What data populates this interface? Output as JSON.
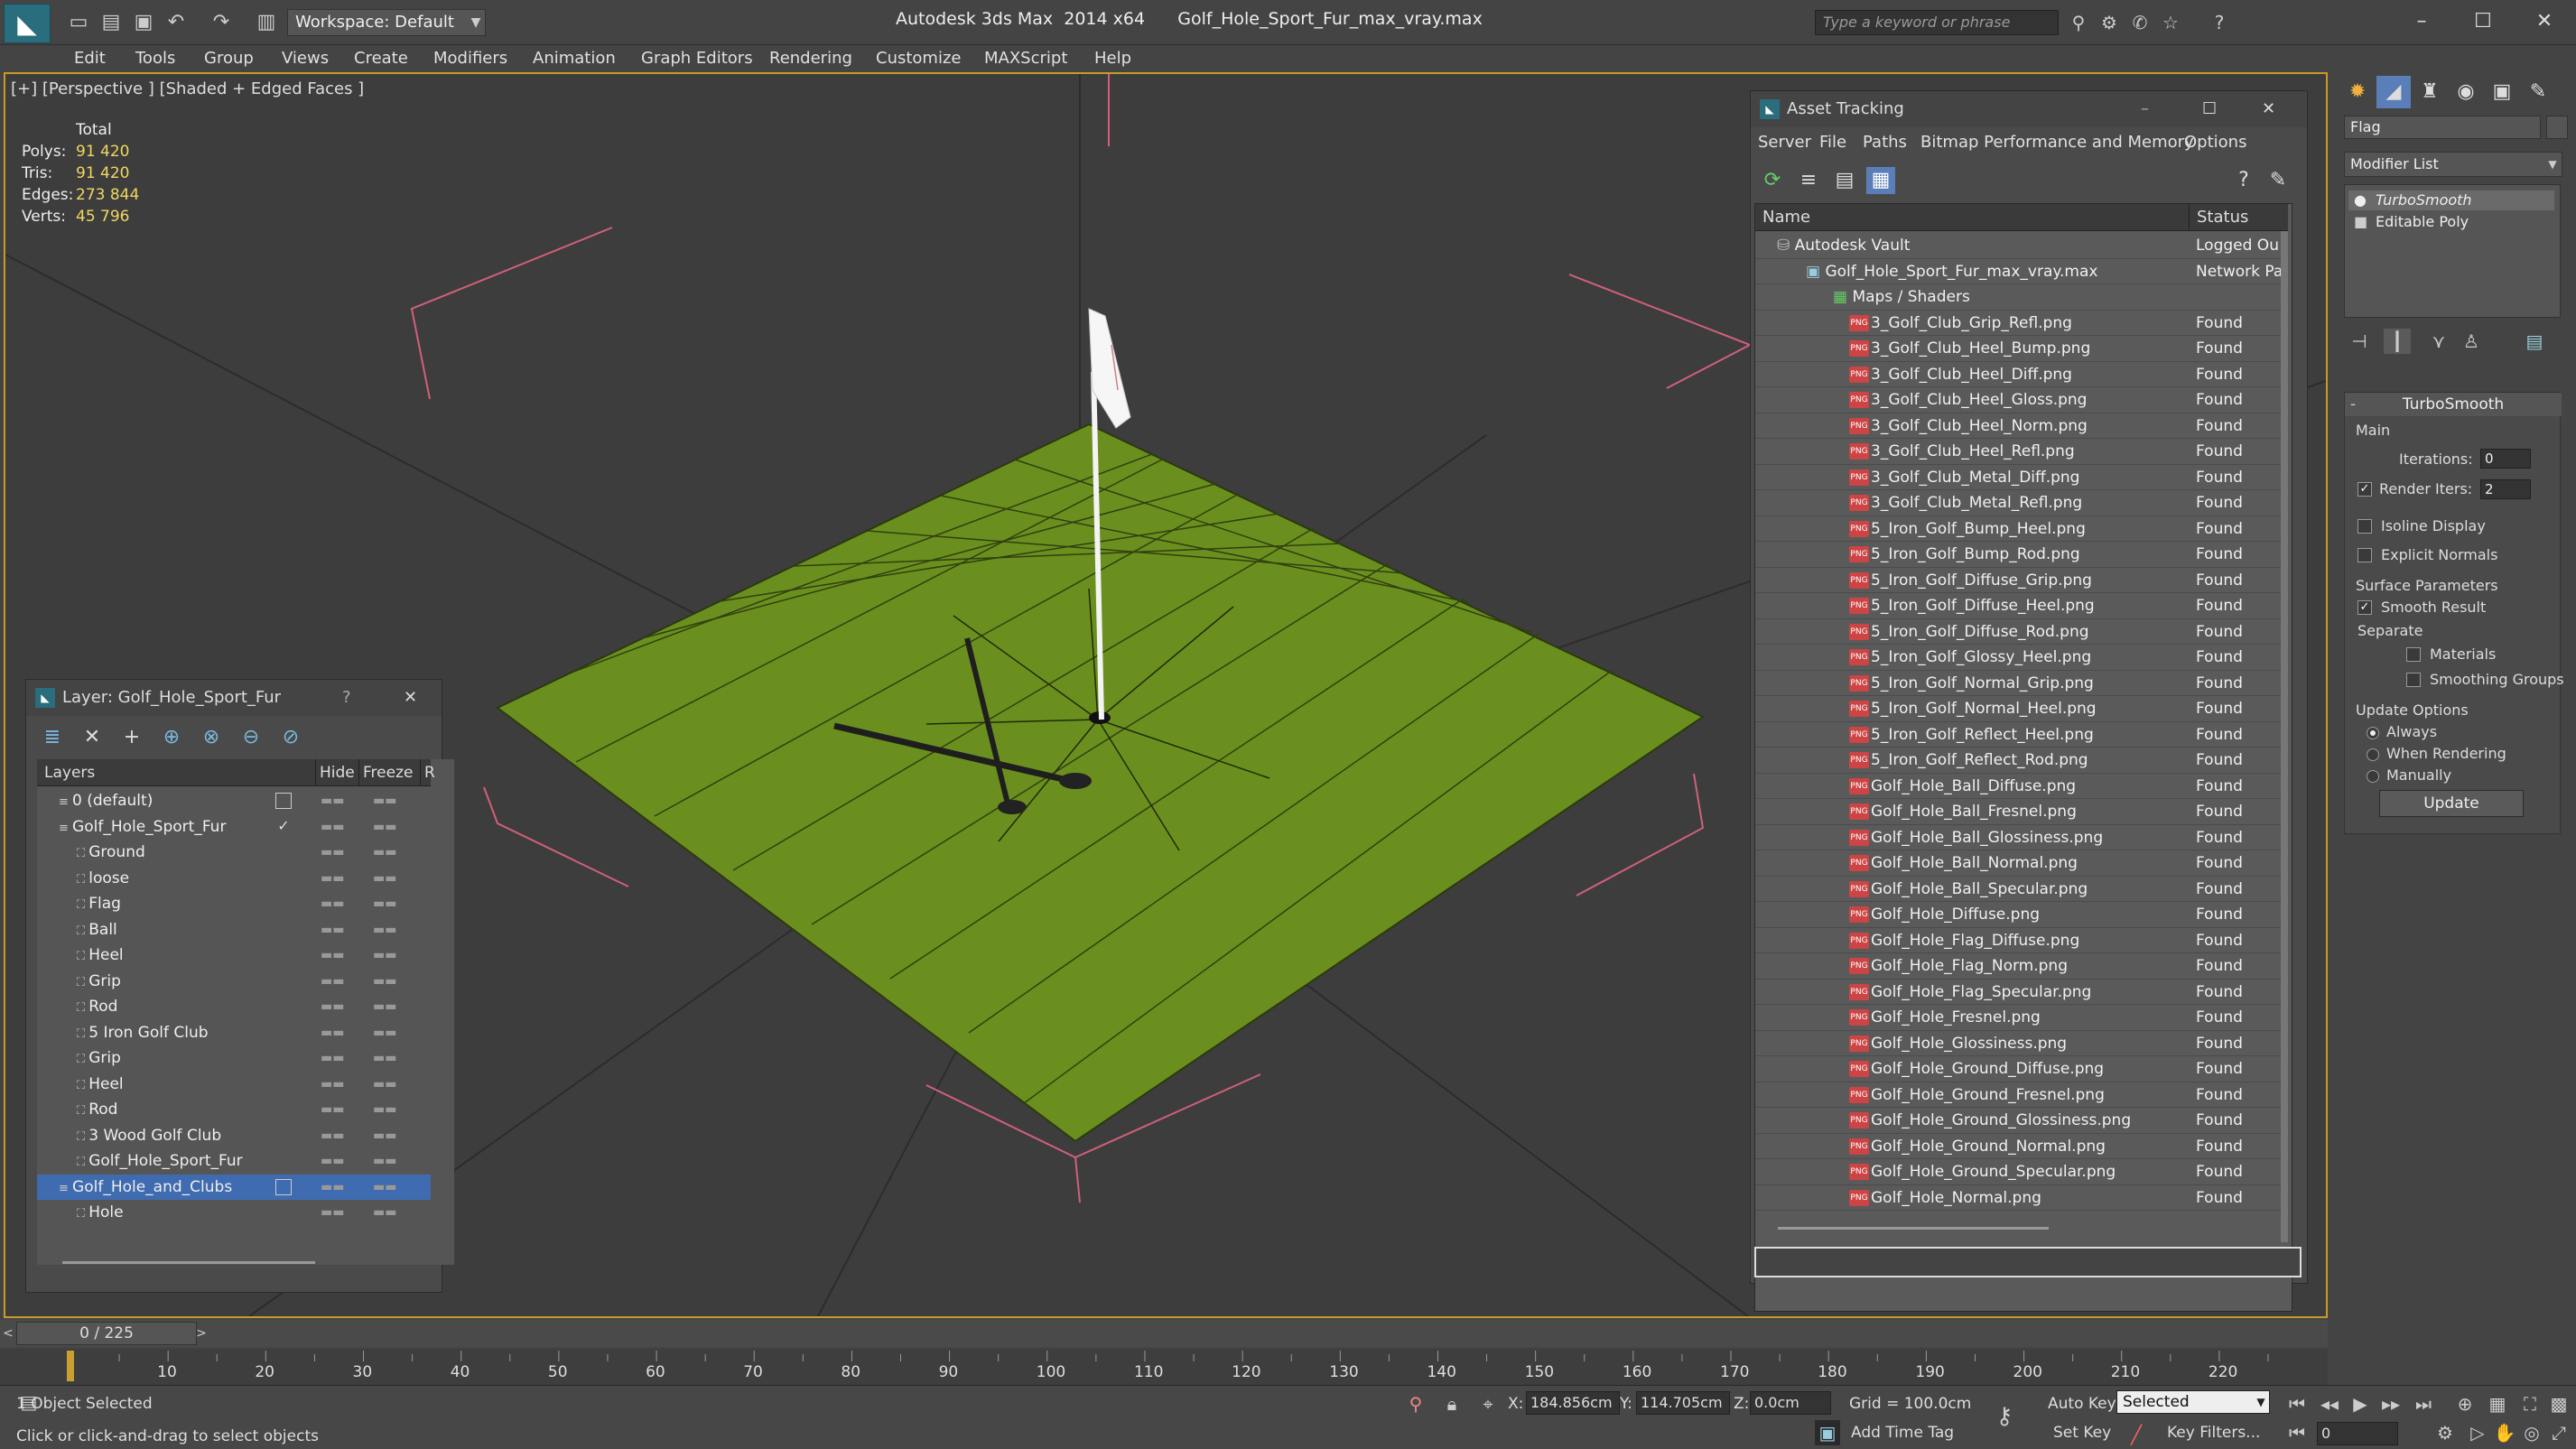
{
  "title_bar": {
    "workspace": "Workspace: Default",
    "app_title": "Autodesk 3ds Max  2014 x64      Golf_Hole_Sport_Fur_max_vray.max",
    "search_placeholder": "Type a keyword or phrase"
  },
  "menu": [
    "Edit",
    "Tools",
    "Group",
    "Views",
    "Create",
    "Modifiers",
    "Animation",
    "Graph Editors",
    "Rendering",
    "Customize",
    "MAXScript",
    "Help"
  ],
  "viewport": {
    "label": "[+] [Perspective ] [Shaded + Edged Faces ]",
    "stats_header": "Total",
    "stats": [
      {
        "k": "Polys:",
        "v": "91 420"
      },
      {
        "k": "Tris:",
        "v": "91 420"
      },
      {
        "k": "Edges:",
        "v": "273 844"
      },
      {
        "k": "Verts:",
        "v": "45 796"
      }
    ]
  },
  "layer_panel": {
    "title": "Layer: Golf_Hole_Sport_Fur",
    "help": "?",
    "col_layers": "Layers",
    "col_hide": "Hide",
    "col_freeze": "Freeze",
    "col_r": "R",
    "rows": [
      {
        "name": "0 (default)",
        "indent": 1,
        "box": true,
        "check": ""
      },
      {
        "name": "Golf_Hole_Sport_Fur",
        "indent": 1,
        "box": false,
        "check": "✓"
      },
      {
        "name": "Ground",
        "indent": 2
      },
      {
        "name": "loose",
        "indent": 2
      },
      {
        "name": "Flag",
        "indent": 2
      },
      {
        "name": "Ball",
        "indent": 2
      },
      {
        "name": "Heel",
        "indent": 2
      },
      {
        "name": "Grip",
        "indent": 2
      },
      {
        "name": "Rod",
        "indent": 2
      },
      {
        "name": "5 Iron Golf Club",
        "indent": 2
      },
      {
        "name": "Grip",
        "indent": 2
      },
      {
        "name": "Heel",
        "indent": 2
      },
      {
        "name": "Rod",
        "indent": 2
      },
      {
        "name": "3 Wood Golf Club",
        "indent": 2
      },
      {
        "name": "Golf_Hole_Sport_Fur",
        "indent": 2
      },
      {
        "name": "Golf_Hole_and_Clubs",
        "indent": 1,
        "box": true,
        "selected": true
      },
      {
        "name": "Hole",
        "indent": 2
      }
    ]
  },
  "asset_panel": {
    "title": "Asset Tracking",
    "menu": [
      "Server",
      "File",
      "Paths",
      "Bitmap Performance and Memory",
      "Options"
    ],
    "col_name": "Name",
    "col_status": "Status",
    "rows": [
      {
        "name": "Autodesk Vault",
        "status": "Logged Ou",
        "level": 0,
        "icon": "vault"
      },
      {
        "name": "Golf_Hole_Sport_Fur_max_vray.max",
        "status": "Network Pa",
        "level": 1,
        "icon": "max"
      },
      {
        "name": "Maps / Shaders",
        "status": "",
        "level": 2,
        "icon": "maps"
      },
      {
        "name": "3_Golf_Club_Grip_Refl.png",
        "status": "Found",
        "level": 3
      },
      {
        "name": "3_Golf_Club_Heel_Bump.png",
        "status": "Found",
        "level": 3
      },
      {
        "name": "3_Golf_Club_Heel_Diff.png",
        "status": "Found",
        "level": 3
      },
      {
        "name": "3_Golf_Club_Heel_Gloss.png",
        "status": "Found",
        "level": 3
      },
      {
        "name": "3_Golf_Club_Heel_Norm.png",
        "status": "Found",
        "level": 3
      },
      {
        "name": "3_Golf_Club_Heel_Refl.png",
        "status": "Found",
        "level": 3
      },
      {
        "name": "3_Golf_Club_Metal_Diff.png",
        "status": "Found",
        "level": 3
      },
      {
        "name": "3_Golf_Club_Metal_Refl.png",
        "status": "Found",
        "level": 3
      },
      {
        "name": "5_Iron_Golf_Bump_Heel.png",
        "status": "Found",
        "level": 3
      },
      {
        "name": "5_Iron_Golf_Bump_Rod.png",
        "status": "Found",
        "level": 3
      },
      {
        "name": "5_Iron_Golf_Diffuse_Grip.png",
        "status": "Found",
        "level": 3
      },
      {
        "name": "5_Iron_Golf_Diffuse_Heel.png",
        "status": "Found",
        "level": 3
      },
      {
        "name": "5_Iron_Golf_Diffuse_Rod.png",
        "status": "Found",
        "level": 3
      },
      {
        "name": "5_Iron_Golf_Glossy_Heel.png",
        "status": "Found",
        "level": 3
      },
      {
        "name": "5_Iron_Golf_Normal_Grip.png",
        "status": "Found",
        "level": 3
      },
      {
        "name": "5_Iron_Golf_Normal_Heel.png",
        "status": "Found",
        "level": 3
      },
      {
        "name": "5_Iron_Golf_Reflect_Heel.png",
        "status": "Found",
        "level": 3
      },
      {
        "name": "5_Iron_Golf_Reflect_Rod.png",
        "status": "Found",
        "level": 3
      },
      {
        "name": "Golf_Hole_Ball_Diffuse.png",
        "status": "Found",
        "level": 3
      },
      {
        "name": "Golf_Hole_Ball_Fresnel.png",
        "status": "Found",
        "level": 3
      },
      {
        "name": "Golf_Hole_Ball_Glossiness.png",
        "status": "Found",
        "level": 3
      },
      {
        "name": "Golf_Hole_Ball_Normal.png",
        "status": "Found",
        "level": 3
      },
      {
        "name": "Golf_Hole_Ball_Specular.png",
        "status": "Found",
        "level": 3
      },
      {
        "name": "Golf_Hole_Diffuse.png",
        "status": "Found",
        "level": 3
      },
      {
        "name": "Golf_Hole_Flag_Diffuse.png",
        "status": "Found",
        "level": 3
      },
      {
        "name": "Golf_Hole_Flag_Norm.png",
        "status": "Found",
        "level": 3
      },
      {
        "name": "Golf_Hole_Flag_Specular.png",
        "status": "Found",
        "level": 3
      },
      {
        "name": "Golf_Hole_Fresnel.png",
        "status": "Found",
        "level": 3
      },
      {
        "name": "Golf_Hole_Glossiness.png",
        "status": "Found",
        "level": 3
      },
      {
        "name": "Golf_Hole_Ground_Diffuse.png",
        "status": "Found",
        "level": 3
      },
      {
        "name": "Golf_Hole_Ground_Fresnel.png",
        "status": "Found",
        "level": 3
      },
      {
        "name": "Golf_Hole_Ground_Glossiness.png",
        "status": "Found",
        "level": 3
      },
      {
        "name": "Golf_Hole_Ground_Normal.png",
        "status": "Found",
        "level": 3
      },
      {
        "name": "Golf_Hole_Ground_Specular.png",
        "status": "Found",
        "level": 3
      },
      {
        "name": "Golf_Hole_Normal.png",
        "status": "Found",
        "level": 3
      }
    ]
  },
  "command_panel": {
    "object_name": "Flag",
    "modifier_list": "Modifier List",
    "stack": [
      "TurboSmooth",
      "Editable Poly"
    ],
    "rollout_title": "TurboSmooth",
    "main": "Main",
    "iterations_label": "Iterations:",
    "iterations": "0",
    "render_iters_label": "Render Iters:",
    "render_iters": "2",
    "isoline": "Isoline Display",
    "explicit_normals": "Explicit Normals",
    "surface_params": "Surface Parameters",
    "smooth_result": "Smooth Result",
    "separate": "Separate",
    "materials": "Materials",
    "smoothing_groups": "Smoothing Groups",
    "update_options": "Update Options",
    "always": "Always",
    "when_rendering": "When Rendering",
    "manually": "Manually",
    "update": "Update"
  },
  "timeline": {
    "frame": "0 / 225",
    "ticks": [
      "10",
      "20",
      "30",
      "40",
      "50",
      "60",
      "70",
      "80",
      "90",
      "100",
      "110",
      "120",
      "130",
      "140",
      "150",
      "160",
      "170",
      "180",
      "190",
      "200",
      "210",
      "220"
    ]
  },
  "status_bar": {
    "selected": "1 Object Selected",
    "prompt": "Click or click-and-drag to select objects",
    "x_label": "X:",
    "x": "184.856cm",
    "y_label": "Y:",
    "y": "114.705cm",
    "z_label": "Z:",
    "z": "0.0cm",
    "grid": "Grid = 100.0cm",
    "auto_key": "Auto Key",
    "selected_dd": "Selected",
    "set_key": "Set Key",
    "key_filters": "Key Filters...",
    "add_time_tag": "Add Time Tag",
    "frame_field": "0"
  },
  "colors": {
    "accent": "#c89b28",
    "selection": "#3f6bb0",
    "grass": "#6b8f1e"
  }
}
